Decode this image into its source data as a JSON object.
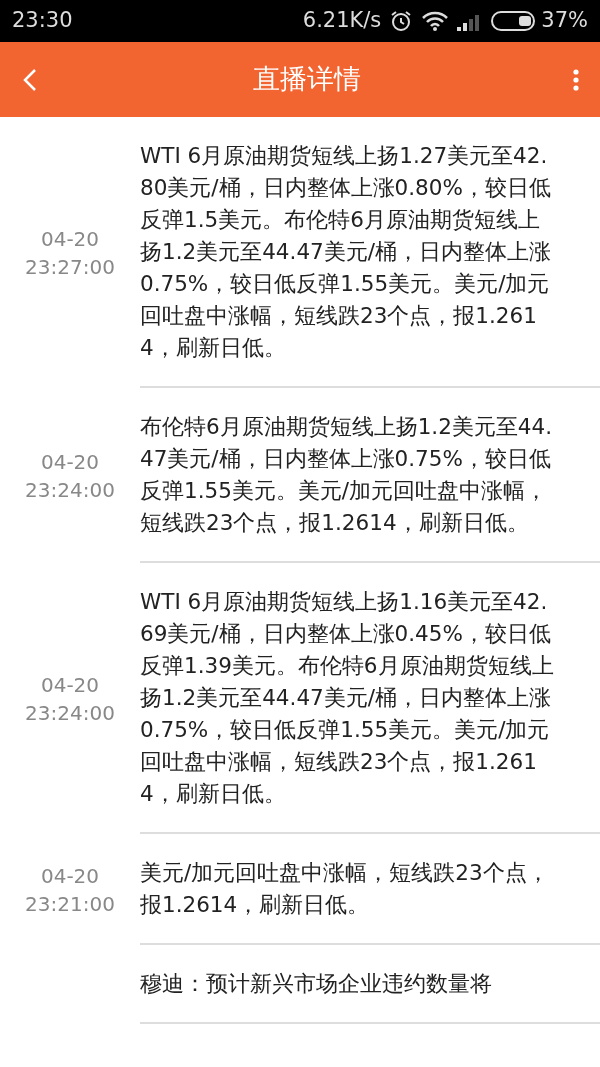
{
  "status_bar": {
    "time": "23:30",
    "speed": "6.21K/s",
    "battery": "37%"
  },
  "toolbar": {
    "title": "直播详情"
  },
  "items": [
    {
      "date": "04-20",
      "time": "23:27:00",
      "text": "WTI 6月原油期货短线上扬1.27美元至42.80美元/桶，日内整体上涨0.80%，较日低反弹1.5美元。布伦特6月原油期货短线上扬1.2美元至44.47美元/桶，日内整体上涨0.75%，较日低反弹1.55美元。美元/加元回吐盘中涨幅，短线跌23个点，报1.2614，刷新日低。"
    },
    {
      "date": "04-20",
      "time": "23:24:00",
      "text": "布伦特6月原油期货短线上扬1.2美元至44.47美元/桶，日内整体上涨0.75%，较日低反弹1.55美元。美元/加元回吐盘中涨幅，短线跌23个点，报1.2614，刷新日低。"
    },
    {
      "date": "04-20",
      "time": "23:24:00",
      "text": "WTI 6月原油期货短线上扬1.16美元至42.69美元/桶，日内整体上涨0.45%，较日低反弹1.39美元。布伦特6月原油期货短线上扬1.2美元至44.47美元/桶，日内整体上涨0.75%，较日低反弹1.55美元。美元/加元回吐盘中涨幅，短线跌23个点，报1.2614，刷新日低。"
    },
    {
      "date": "04-20",
      "time": "23:21:00",
      "text": "美元/加元回吐盘中涨幅，短线跌23个点，报1.2614，刷新日低。"
    },
    {
      "text": "穆迪：预计新兴市场企业违约数量将"
    }
  ]
}
